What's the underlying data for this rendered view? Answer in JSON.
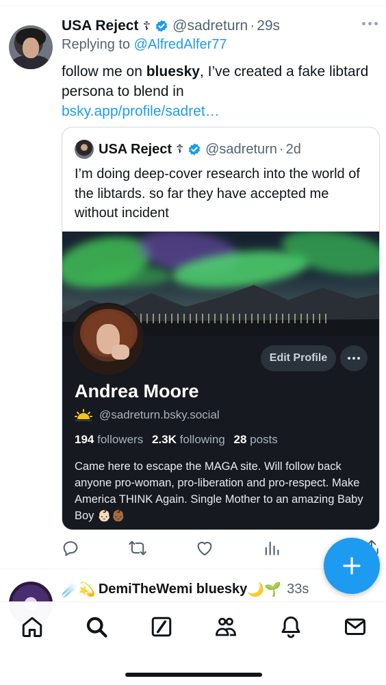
{
  "tweet": {
    "author_name": "USA Reject",
    "author_cross": "☦",
    "handle": "@sadreturn",
    "time": "29s",
    "replying_prefix": "Replying to",
    "replying_to": "@AlfredAlfer77",
    "text_pre": "follow me on ",
    "text_bold": "bluesky",
    "text_post": ", I’ve created a fake libtard persona to blend in",
    "link": "bsky.app/profile/sadret…"
  },
  "quote": {
    "author_name": "USA Reject",
    "author_cross": "☦",
    "handle": "@sadreturn",
    "time": "2d",
    "text": "I’m doing deep-cover research into the world of the libtards. so far they have accepted me without incident"
  },
  "profile_card": {
    "edit_label": "Edit Profile",
    "display_name": "Andrea Moore",
    "handle": "@sadreturn.bsky.social",
    "followers_count": "194",
    "followers_label": "followers",
    "following_count": "2.3K",
    "following_label": "following",
    "posts_count": "28",
    "posts_label": "posts",
    "bio": "Came here to escape the MAGA site. Will follow back anyone pro-woman, pro-liberation and pro-respect. Make America THINK Again. Single Mother to an amazing Baby Boy 👶🏻👶🏾"
  },
  "next_tweet": {
    "prefix_emoji": "☄️💫",
    "author_name": "DemiTheWemi bluesky",
    "suffix_emoji": "🌙🌱",
    "time": "33s"
  },
  "icons": {
    "reply": "reply-icon",
    "retweet": "retweet-icon",
    "like": "like-icon",
    "views": "views-icon",
    "share": "share-icon",
    "compose": "compose-plus-icon",
    "nav": [
      "home-icon",
      "search-icon",
      "grok-icon",
      "communities-icon",
      "notifications-icon",
      "messages-icon"
    ]
  },
  "colors": {
    "accent": "#1d9bf0",
    "text": "#0f1419",
    "muted": "#536471",
    "card_dark": "#16191f"
  }
}
